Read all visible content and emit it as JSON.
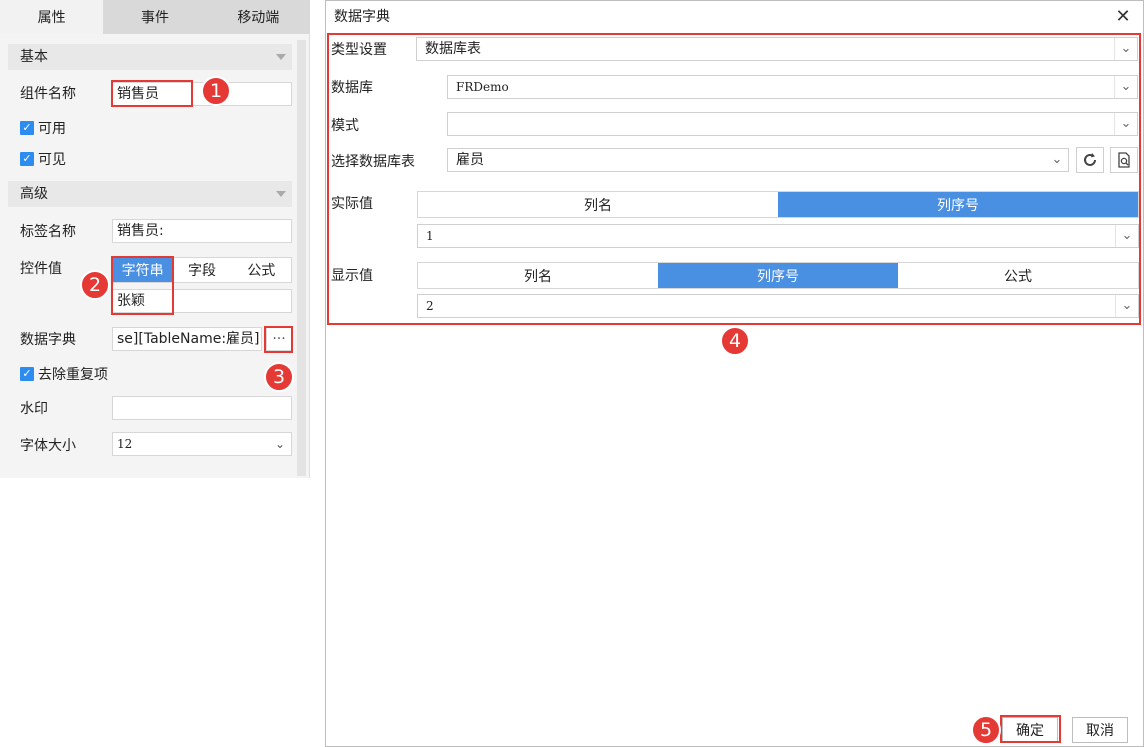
{
  "panel": {
    "tabs": [
      "属性",
      "事件",
      "移动端"
    ],
    "basic_section": "基本",
    "advanced_section": "高级",
    "component_name_label": "组件名称",
    "component_name_value": "销售员",
    "enabled_label": "可用",
    "visible_label": "可见",
    "tag_name_label": "标签名称",
    "tag_name_value": "销售员:",
    "control_value_label": "控件值",
    "control_value_modes": [
      "字符串",
      "字段",
      "公式"
    ],
    "control_value_value": "张颖",
    "dict_label": "数据字典",
    "dict_value": "se][TableName:雇员]",
    "dict_btn": "···",
    "dedup_label": "去除重复项",
    "watermark_label": "水印",
    "watermark_value": "",
    "font_size_label": "字体大小",
    "font_size_value": "12"
  },
  "badges": [
    "1",
    "2",
    "3",
    "4",
    "5"
  ],
  "dialog": {
    "title": "数据字典",
    "close": "✕",
    "type_label": "类型设置",
    "type_value": "数据库表",
    "db_label": "数据库",
    "db_value": "FRDemo",
    "schema_label": "模式",
    "schema_value": "",
    "table_label": "选择数据库表",
    "table_value": "雇员",
    "actual_label": "实际值",
    "actual_modes": [
      "列名",
      "列序号"
    ],
    "actual_value": "1",
    "display_label": "显示值",
    "display_modes": [
      "列名",
      "列序号",
      "公式"
    ],
    "display_value": "2",
    "ok": "确定",
    "cancel": "取消"
  },
  "colors": {
    "accent": "#4a90e2",
    "highlight": "#e53935"
  }
}
